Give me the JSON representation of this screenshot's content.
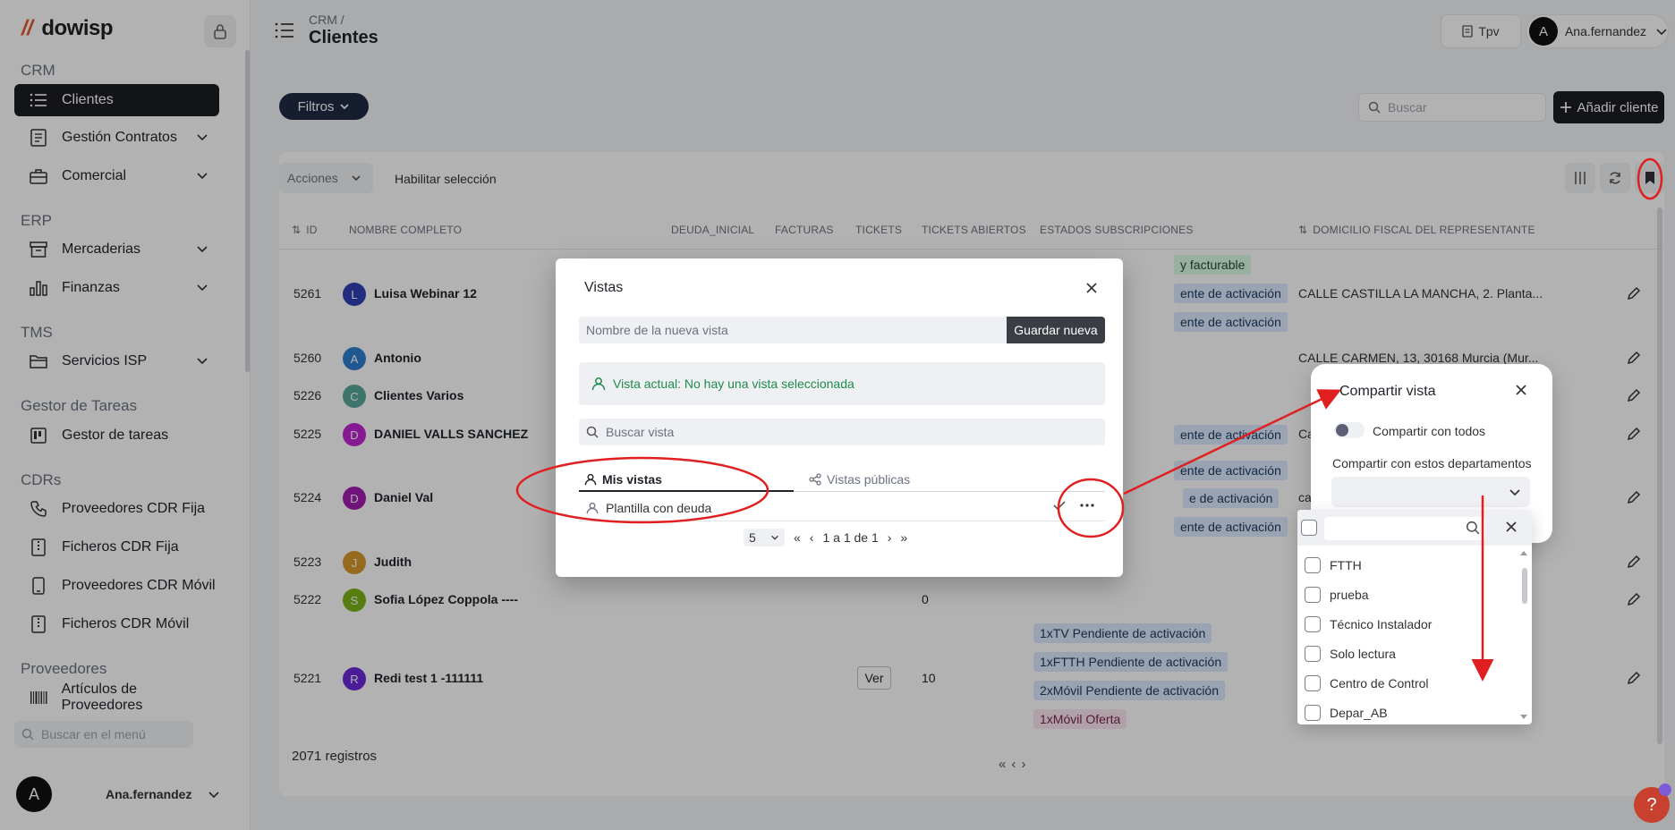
{
  "sidebar": {
    "logo": "dowisp",
    "sections": {
      "crm": "CRM",
      "erp": "ERP",
      "tms": "TMS",
      "tareas": "Gestor de Tareas",
      "cdrs": "CDRs",
      "proveedores": "Proveedores"
    },
    "items": {
      "clientes": "Clientes",
      "contratos": "Gestión Contratos",
      "comercial": "Comercial",
      "mercaderias": "Mercaderias",
      "finanzas": "Finanzas",
      "servicios": "Servicios ISP",
      "gestor": "Gestor de tareas",
      "prov_fija": "Proveedores CDR Fija",
      "fich_fija": "Ficheros CDR Fija",
      "prov_movil": "Proveedores CDR Móvil",
      "fich_movil": "Ficheros CDR Móvil",
      "articulos": "Artículos de Proveedores"
    },
    "search_placeholder": "Buscar en el menú",
    "user": {
      "initial": "A",
      "name": "Ana.fernandez"
    }
  },
  "header": {
    "breadcrumb": "CRM /",
    "title": "Clientes",
    "tpv": "Tpv",
    "user_initial": "A",
    "user_name": "Ana.fernandez"
  },
  "toolbar": {
    "filtros": "Filtros",
    "search_placeholder": "Buscar",
    "add_cliente": "Añadir cliente",
    "acciones": "Acciones",
    "habilitar": "Habilitar selección"
  },
  "table": {
    "columns": {
      "id": "ID",
      "nombre": "NOMBRE COMPLETO",
      "deuda": "DEUDA_INICIAL",
      "facturas": "FACTURAS",
      "tickets": "TICKETS",
      "tickets_abiertos": "TICKETS ABIERTOS",
      "estados": "ESTADOS SUBSCRIPCIONES",
      "domicilio": "DOMICILIO FISCAL DEL REPRESENTANTE"
    },
    "rows": [
      {
        "id": "5261",
        "initial": "L",
        "name": "Luisa Webinar 12",
        "color": "#2f3fb5",
        "addr": "CALLE CASTILLA LA MANCHA, 2. Planta..."
      },
      {
        "id": "5260",
        "initial": "A",
        "name": "Antonio",
        "color": "#2f7fd1",
        "addr": "CALLE CARMEN, 13, 30168 Murcia (Mur..."
      },
      {
        "id": "5226",
        "initial": "C",
        "name": "Clientes Varios",
        "color": "#58a79a",
        "addr": ""
      },
      {
        "id": "5225",
        "initial": "D",
        "name": "DANIEL VALLS SANCHEZ",
        "color": "#c026d3",
        "addr": "Ca"
      },
      {
        "id": "5224",
        "initial": "D",
        "name": "Daniel Val",
        "color": "#a21caf",
        "addr": "ca"
      },
      {
        "id": "5223",
        "initial": "J",
        "name": "Judith",
        "color": "#d89a2b",
        "addr": ""
      },
      {
        "id": "5222",
        "initial": "S",
        "name": "Sofia López Coppola ----",
        "color": "#7ab317",
        "addr": ""
      },
      {
        "id": "5221",
        "initial": "R",
        "name": "Redi test 1 -111111",
        "color": "#6d28d9",
        "addr": ""
      }
    ],
    "badges": {
      "r1a": "y facturable",
      "r1b": "ente de activación",
      "r1c": "ente de activación",
      "r4a": "ente de activación",
      "r5a": "ente de activación",
      "r5b": "e de activación",
      "r5c": "ente de activación",
      "r8a": "1xTV Pendiente de activación",
      "r8b": "1xFTTH Pendiente de activación",
      "r8c": "2xMóvil Pendiente de activación",
      "r8d": "1xMóvil Oferta"
    },
    "row_5222_tickets_abiertos": "0",
    "row_5221_ver": "Ver",
    "row_5221_tickets_abiertos": "10",
    "registros": "2071 registros"
  },
  "vistas_modal": {
    "title": "Vistas",
    "new_name_placeholder": "Nombre de la nueva vista",
    "save_new": "Guardar nueva",
    "current": "Vista actual: No hay una vista seleccionada",
    "search_placeholder": "Buscar vista",
    "tab_mis": "Mis vistas",
    "tab_publicas": "Vistas públicas",
    "view_item": "Plantilla con deuda",
    "page_size": "5",
    "page_info": "1 a 1 de 1"
  },
  "share_panel": {
    "title": "Compartir vista",
    "toggle_label": "Compartir con todos",
    "departments_label": "Compartir con estos departamentos",
    "options": [
      "FTTH",
      "prueba",
      "Técnico Instalador",
      "Solo lectura",
      "Centro de Control",
      "Depar_AB"
    ]
  },
  "help": "?",
  "colors": {
    "annotation": "#e02020",
    "active": "#1b1d21",
    "success": "#1f8a4c"
  }
}
